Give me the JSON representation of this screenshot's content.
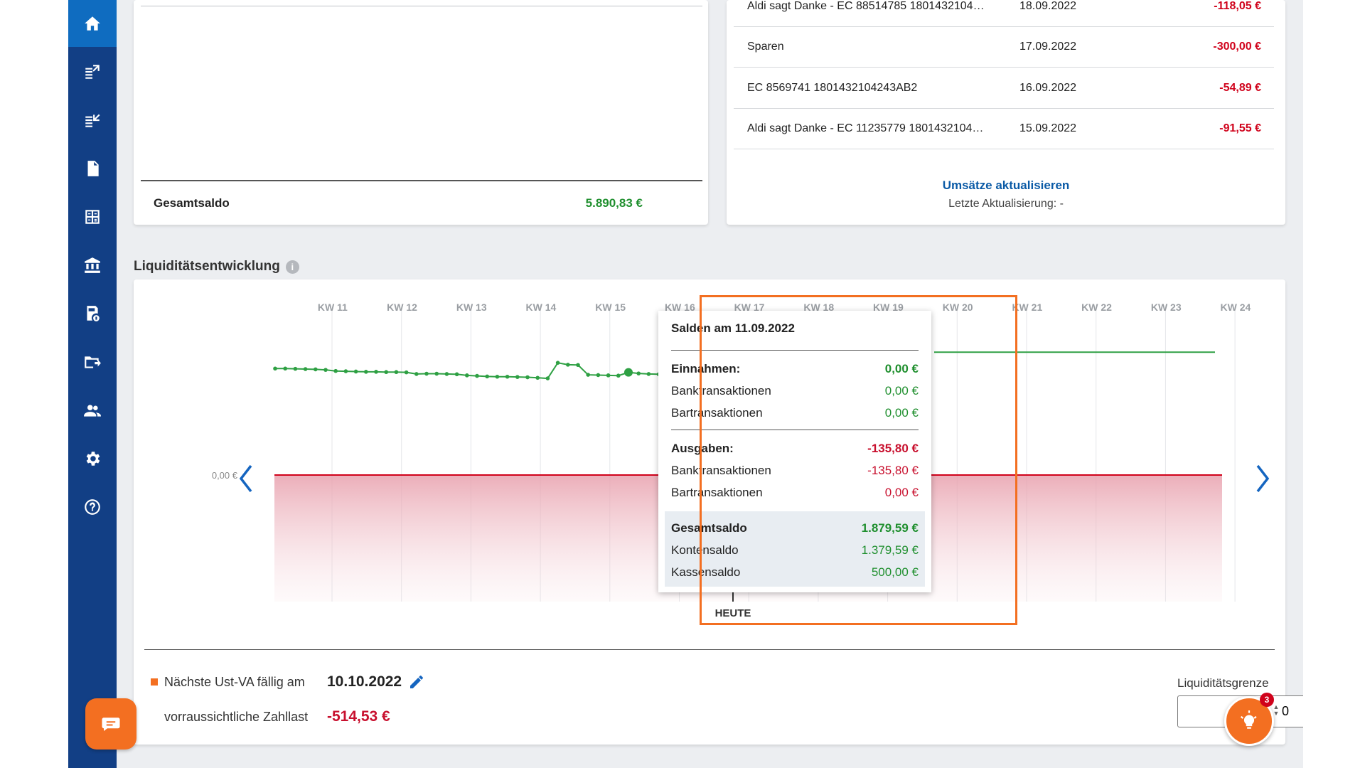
{
  "accounts_card": {
    "total_label": "Gesamtsaldo",
    "total_value": "5.890,83 €"
  },
  "transactions": {
    "rows": [
      {
        "desc": "Aldi sagt Danke - EC 88514785 1801432104…",
        "date": "18.09.2022",
        "amount": "-118,05 €"
      },
      {
        "desc": "Sparen",
        "date": "17.09.2022",
        "amount": "-300,00 €"
      },
      {
        "desc": "EC 8569741 1801432104243AB2",
        "date": "16.09.2022",
        "amount": "-54,89 €"
      },
      {
        "desc": "Aldi sagt Danke - EC 11235779 1801432104…",
        "date": "15.09.2022",
        "amount": "-91,55 €"
      }
    ],
    "refresh_label": "Umsätze aktualisieren",
    "last_update": "Letzte Aktualisierung: -"
  },
  "liquidity": {
    "title": "Liquiditätsentwicklung",
    "info_glyph": "i",
    "zero_label": "0,00 €",
    "today_label": "HEUTE",
    "tooltip": {
      "title": "Salden am 11.09.2022",
      "income_label": "Einnahmen:",
      "income_value": "0,00 €",
      "bank_label": "Banktransaktionen",
      "income_bank": "0,00 €",
      "cash_label": "Bartransaktionen",
      "income_cash": "0,00 €",
      "expense_label": "Ausgaben:",
      "expense_value": "-135,80 €",
      "expense_bank": "-135,80 €",
      "expense_cash": "0,00 €",
      "total_label": "Gesamtsaldo",
      "total_value": "1.879,59 €",
      "account_label": "Kontensaldo",
      "account_value": "1.379,59 €",
      "cash_balance_label": "Kassensaldo",
      "cash_balance_value": "500,00 €"
    }
  },
  "chart_data": {
    "type": "line",
    "categories": [
      "KW 11",
      "KW 12",
      "KW 13",
      "KW 14",
      "KW 15",
      "KW 16",
      "KW 17",
      "KW 18",
      "KW 19",
      "KW 20",
      "KW 21",
      "KW 22",
      "KW 23",
      "KW 24"
    ],
    "series": [
      {
        "values": [
          1950,
          1950,
          1945,
          1940,
          1935,
          1925,
          1905,
          1900,
          1895,
          1890,
          1890,
          1885,
          1885,
          1880,
          1850,
          1855,
          1855,
          1850,
          1845,
          1825,
          1815,
          1805,
          1800,
          1800,
          1795,
          1790,
          1780,
          1770,
          2055,
          2020,
          2015,
          1835,
          1830,
          1825,
          1820,
          1879.59,
          1860,
          1850,
          1845
        ],
        "color": "#2ea043"
      },
      {
        "color": "#2ea043",
        "values": [
          2250,
          2250,
          2250,
          2250,
          2250,
          2250
        ]
      }
    ],
    "xlabel": "",
    "ylabel": "",
    "zero_label": "0,00 €",
    "liquidity_limit": 0,
    "limit_color": "#d0021b"
  },
  "footer": {
    "vat_label": "Nächste Ust-VA fällig am",
    "vat_date": "10.10.2022",
    "payload_label": "vorraussichtliche Zahllast",
    "payload_value": "-514,53 €",
    "limit_label": "Liquiditätsgrenze",
    "limit_value": "0"
  },
  "badge_count": "3",
  "nav": [
    "home-icon",
    "export-icon",
    "import-icon",
    "document-icon",
    "calculator-icon",
    "bank-icon",
    "cash-register-icon",
    "folder-icon",
    "users-icon",
    "gear-icon",
    "help-icon"
  ]
}
